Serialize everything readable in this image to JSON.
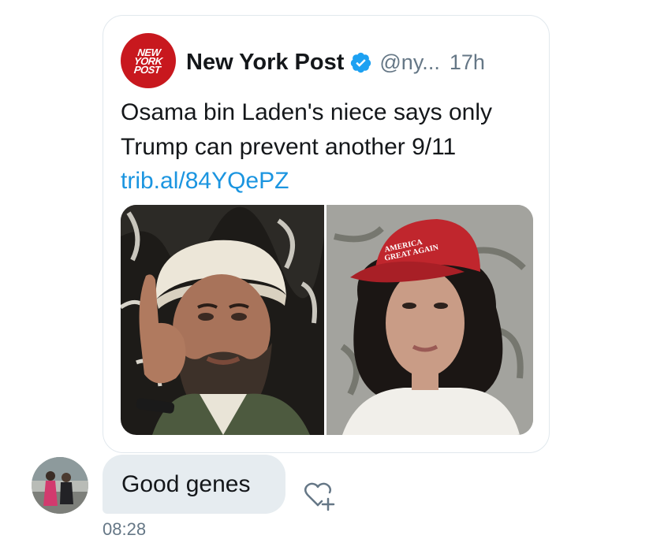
{
  "tweet": {
    "author_logo_text": [
      "NEW",
      "YORK",
      "POST"
    ],
    "display_name": "New York Post",
    "handle": "@ny...",
    "time": "17h",
    "text": "Osama bin Laden's niece says only Trump can prevent another 9/11",
    "link": "trib.al/84YQePZ",
    "photo_right_cap_text": [
      "AMERICA",
      "GREAT AGAIN"
    ]
  },
  "message": {
    "text": "Good genes",
    "time": "08:28"
  },
  "icons": {
    "verified": "verified-badge-icon",
    "react": "heart-plus-icon"
  },
  "colors": {
    "brand_red": "#c8181e",
    "verified_blue": "#1da1f2",
    "link_blue": "#1b95e0",
    "secondary_text": "#657786",
    "bubble_bg": "#e6ecf0",
    "card_border": "#e1e8ed"
  }
}
